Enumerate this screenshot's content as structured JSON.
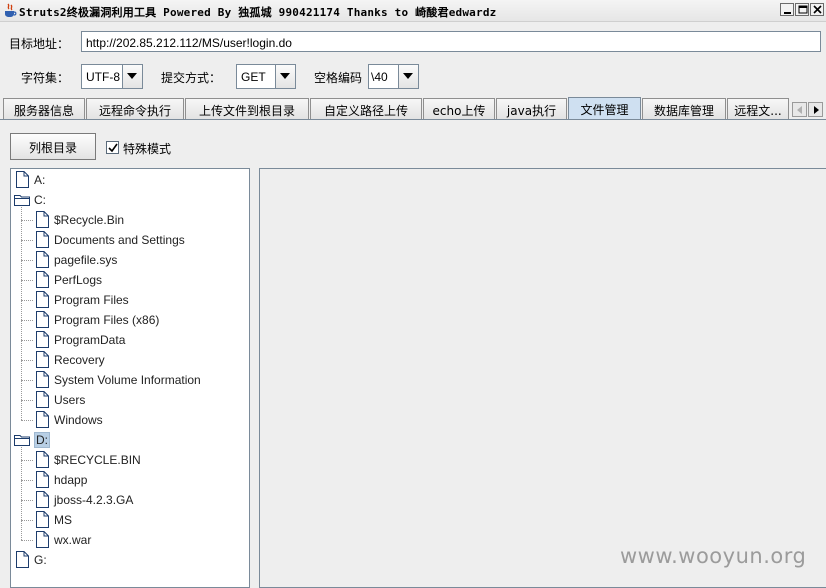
{
  "window": {
    "title": "Struts2终极漏洞利用工具  Powered By 独孤城 990421174 Thanks to 崎酸君edwardz"
  },
  "form": {
    "target_label": "目标地址：",
    "target_url": "http://202.85.212.112/MS/user!login.do",
    "charset_label": "字符集：",
    "charset_value": "UTF-8",
    "method_label": "提交方式：",
    "method_value": "GET",
    "space_label": "空格编码",
    "space_value": "\\40"
  },
  "tabs": [
    {
      "label": "服务器信息",
      "active": false
    },
    {
      "label": "远程命令执行",
      "active": false
    },
    {
      "label": "上传文件到根目录",
      "active": false
    },
    {
      "label": "自定义路径上传",
      "active": false
    },
    {
      "label": "echo上传",
      "active": false
    },
    {
      "label": "java执行",
      "active": false
    },
    {
      "label": "文件管理",
      "active": true
    },
    {
      "label": "数据库管理",
      "active": false
    },
    {
      "label": "远程文...",
      "active": false
    }
  ],
  "file_manager": {
    "list_root_button": "列根目录",
    "special_mode_label": "特殊模式",
    "special_mode_checked": true,
    "tree": [
      {
        "name": "A:",
        "type": "drive-file",
        "level": 0
      },
      {
        "name": "C:",
        "type": "folder-open",
        "level": 0
      },
      {
        "name": "$Recycle.Bin",
        "type": "file",
        "level": 1
      },
      {
        "name": "Documents and Settings",
        "type": "file",
        "level": 1
      },
      {
        "name": "pagefile.sys",
        "type": "file",
        "level": 1
      },
      {
        "name": "PerfLogs",
        "type": "file",
        "level": 1
      },
      {
        "name": "Program Files",
        "type": "file",
        "level": 1
      },
      {
        "name": "Program Files (x86)",
        "type": "file",
        "level": 1
      },
      {
        "name": "ProgramData",
        "type": "file",
        "level": 1
      },
      {
        "name": "Recovery",
        "type": "file",
        "level": 1
      },
      {
        "name": "System Volume Information",
        "type": "file",
        "level": 1
      },
      {
        "name": "Users",
        "type": "file",
        "level": 1
      },
      {
        "name": "Windows",
        "type": "file",
        "level": 1
      },
      {
        "name": "D:",
        "type": "folder-open",
        "level": 0,
        "selected": true
      },
      {
        "name": "$RECYCLE.BIN",
        "type": "file",
        "level": 1
      },
      {
        "name": "hdapp",
        "type": "file",
        "level": 1
      },
      {
        "name": "jboss-4.2.3.GA",
        "type": "file",
        "level": 1
      },
      {
        "name": "MS",
        "type": "file",
        "level": 1
      },
      {
        "name": "wx.war",
        "type": "file",
        "level": 1
      },
      {
        "name": "G:",
        "type": "drive-file",
        "level": 0
      }
    ]
  },
  "watermark": "www.wooyun.org",
  "colors": {
    "active_tab": "#cfe0f1",
    "selection": "#b8cfe5",
    "border": "#7a8a99"
  }
}
